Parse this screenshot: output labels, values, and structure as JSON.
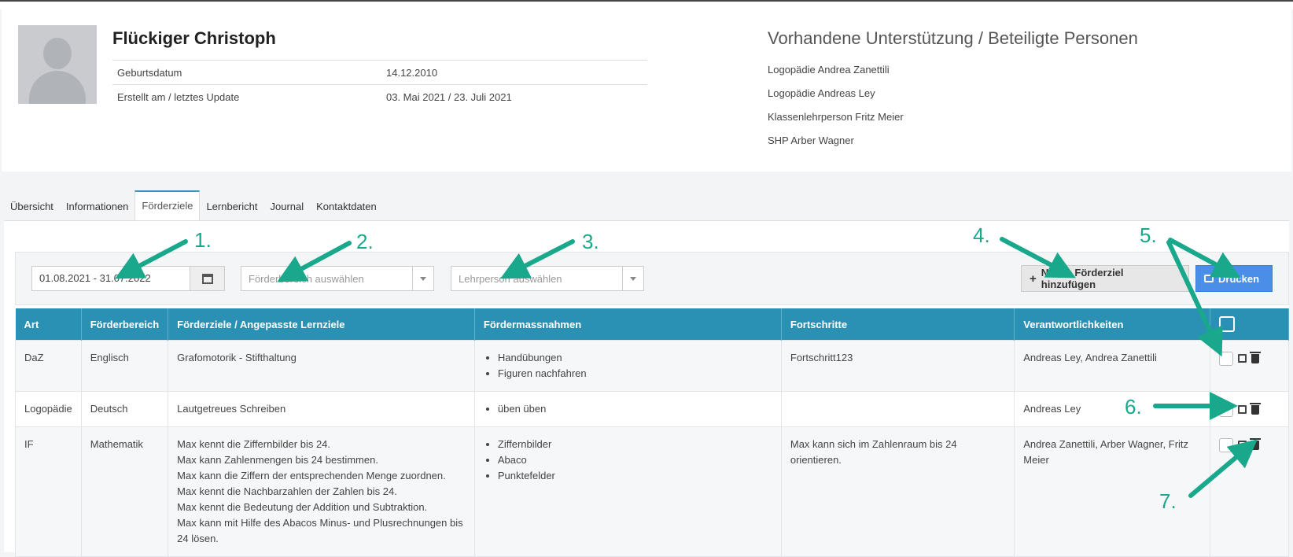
{
  "profile": {
    "name": "Flückiger Christoph",
    "rows": [
      {
        "label": "Geburtsdatum",
        "value": "14.12.2010"
      },
      {
        "label": "Erstellt am / letztes Update",
        "value": "03. Mai 2021 / 23. Juli 2021"
      }
    ]
  },
  "support": {
    "title": "Vorhandene Unterstützung / Beteiligte Personen",
    "people": [
      "Logopädie Andrea Zanettili",
      "Logopädie Andreas Ley",
      "Klassenlehrperson Fritz Meier",
      "SHP Arber Wagner"
    ]
  },
  "tabs": [
    "Übersicht",
    "Informationen",
    "Förderziele",
    "Lernbericht",
    "Journal",
    "Kontaktdaten"
  ],
  "active_tab": "Förderziele",
  "filters": {
    "date_range": "01.08.2021 - 31.07.2022",
    "area_placeholder": "Förderbereich auswählen",
    "teacher_placeholder": "Lehrperson auswählen"
  },
  "buttons": {
    "add": "Neues Förderziel hinzufügen",
    "print": "Drucken"
  },
  "icons": {
    "add": "plus-icon",
    "print": "print-icon",
    "calendar": "calendar-icon",
    "edit": "edit-icon",
    "delete": "trash-icon"
  },
  "colors": {
    "accent": "#2a91b5",
    "primary_button": "#4a8ee8",
    "annotation": "#19a88c"
  },
  "table": {
    "headers": [
      "Art",
      "Förderbereich",
      "Förderziele / Angepasste Lernziele",
      "Fördermassnahmen",
      "Fortschritte",
      "Verantwortlichkeiten"
    ],
    "rows": [
      {
        "art": "DaZ",
        "bereich": "Englisch",
        "ziele": [
          "Grafomotorik - Stifthaltung"
        ],
        "massnahmen": [
          "Handübungen",
          "Figuren nachfahren"
        ],
        "fortschritte": "Fortschritt123",
        "verantwortlich": "Andreas Ley, Andrea Zanettili"
      },
      {
        "art": "Logopädie",
        "bereich": "Deutsch",
        "ziele": [
          "Lautgetreues Schreiben"
        ],
        "massnahmen": [
          "üben üben"
        ],
        "fortschritte": "",
        "verantwortlich": "Andreas Ley"
      },
      {
        "art": "IF",
        "bereich": "Mathematik",
        "ziele": [
          "Max kennt die Ziffernbilder bis 24.",
          "Max kann Zahlenmengen bis 24 bestimmen.",
          "Max kann die Ziffern der entsprechenden Menge zuordnen.",
          "Max kennt die Nachbarzahlen der Zahlen bis 24.",
          "Max kennt die Bedeutung der Addition und Subtraktion.",
          "Max kann mit Hilfe des Abacos Minus- und Plusrechnungen bis 24 lösen."
        ],
        "massnahmen": [
          "Ziffernbilder",
          "Abaco",
          "Punktefelder"
        ],
        "fortschritte": "Max kann sich im Zahlenraum bis 24 orientieren.",
        "verantwortlich": "Andrea Zanettili, Arber Wagner, Fritz Meier"
      }
    ]
  },
  "annotations": [
    "1.",
    "2.",
    "3.",
    "4.",
    "5.",
    "6.",
    "7."
  ]
}
